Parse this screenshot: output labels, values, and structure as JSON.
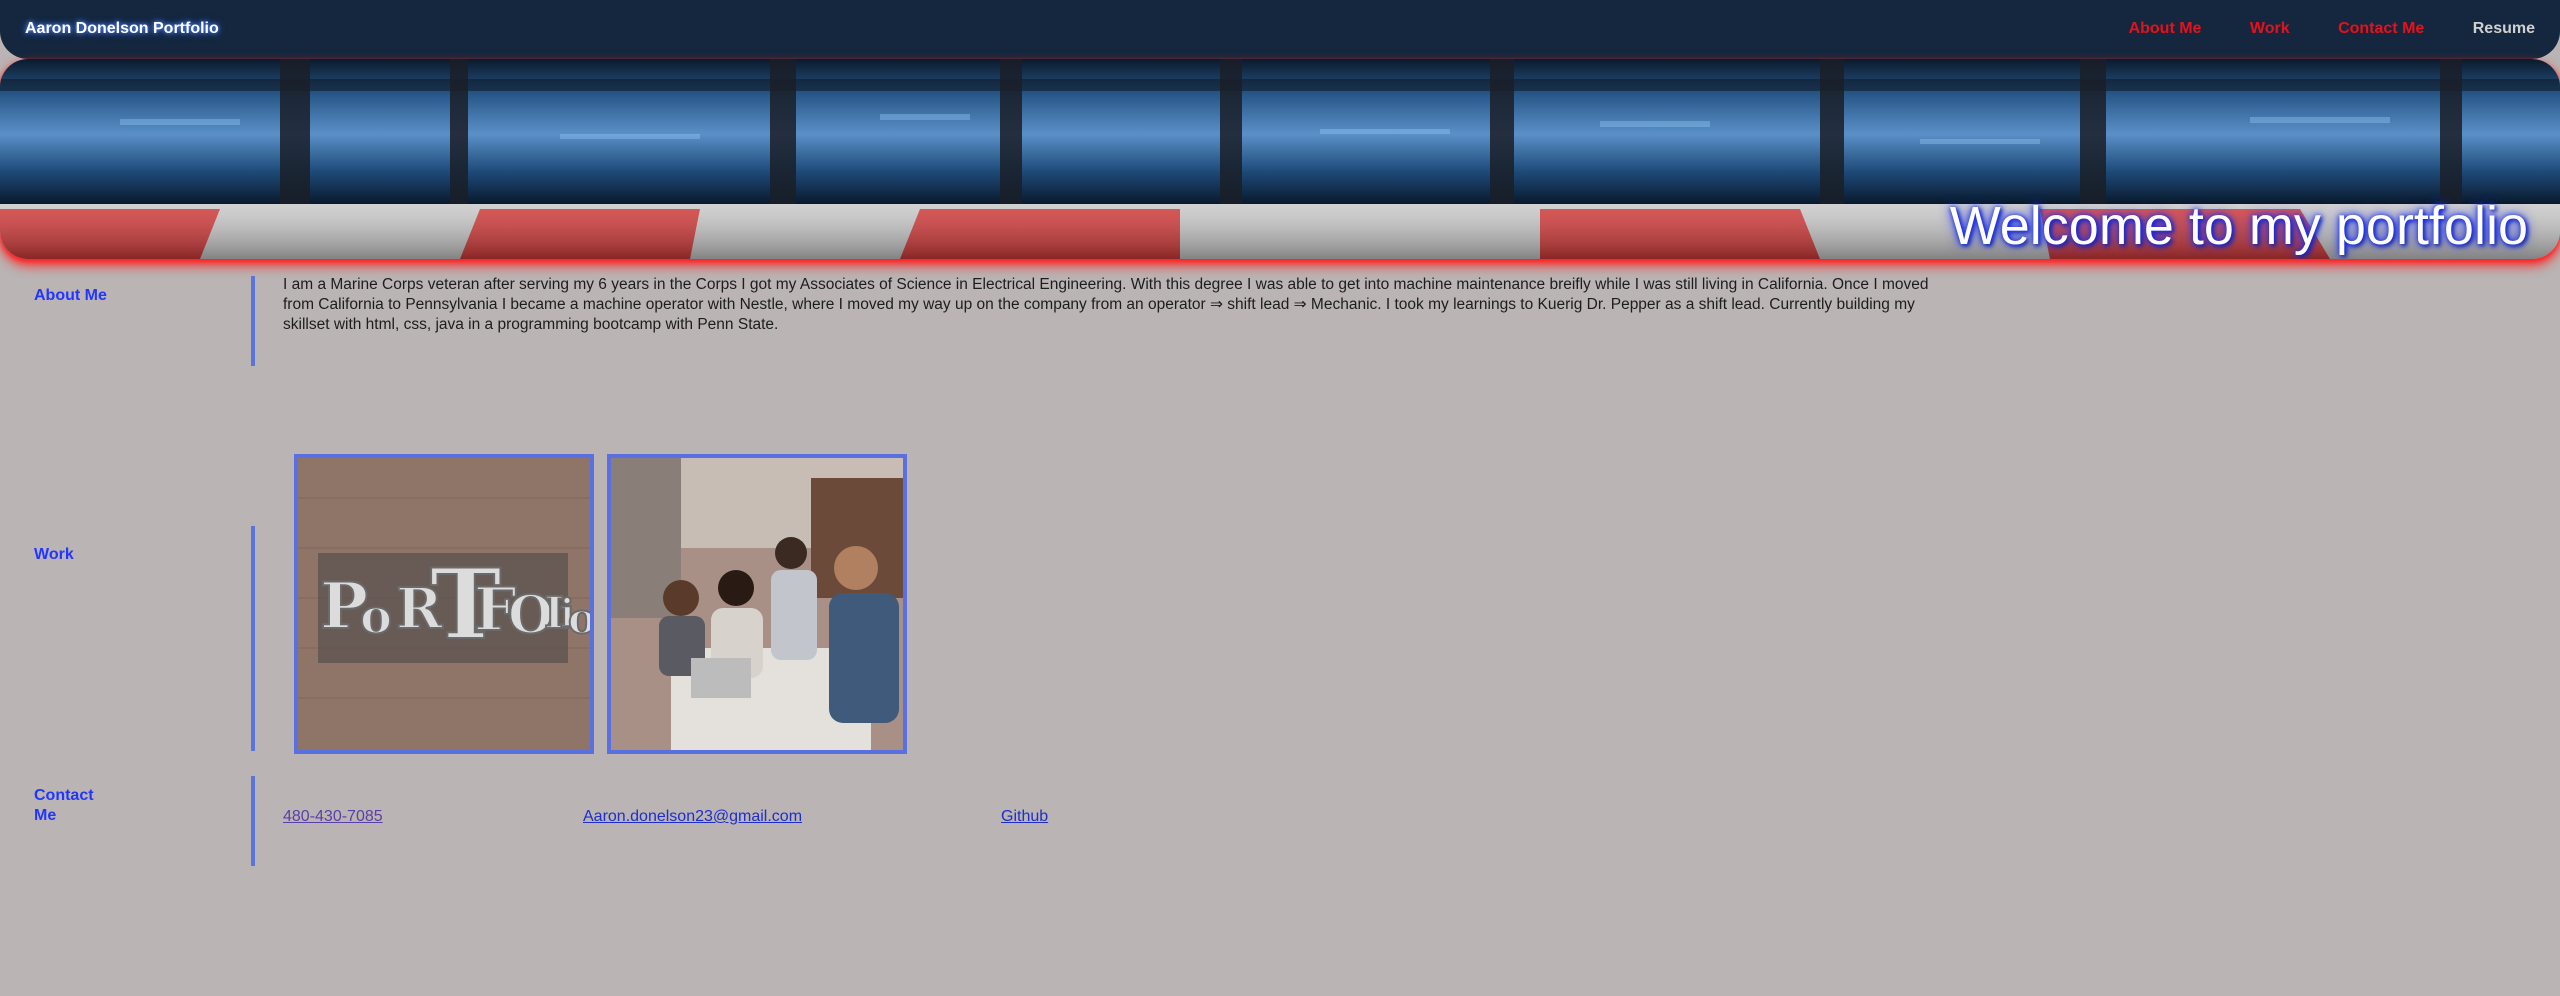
{
  "nav": {
    "brand": "Aaron Donelson Portfolio",
    "links": [
      "About Me",
      "Work",
      "Contact Me",
      "Resume"
    ]
  },
  "hero": {
    "title": "Welcome to my portfolio"
  },
  "about": {
    "label": "About Me",
    "text": "I am a Marine Corps veteran after serving my 6 years in the Corps I got my Associates of Science in Electrical Engineering. With this degree I was able to get into machine maintenance breifly while I was still living in California. Once I moved from California to Pennsylvania I became a machine operator with Nestle, where I moved my way up on the company from an operator ⇒ shift lead ⇒ Mechanic. I took my learnings to Kuerig Dr. Pepper as a shift lead. Currently building my skillset with html, css, java in a programming bootcamp with Penn State."
  },
  "work": {
    "label": "Work",
    "images": [
      "portfolio-letterpress-image",
      "team-meeting-image"
    ]
  },
  "contact": {
    "label": "Contact Me",
    "phone": "480-430-7085",
    "email": "Aaron.donelson23@gmail.com",
    "github": "Github"
  },
  "colors": {
    "nav_bg": "#14273e",
    "nav_link": "#e8101a",
    "section_label": "#2336ff",
    "page_bg": "#bab4b4",
    "accent_bar": "#5a74d8"
  }
}
